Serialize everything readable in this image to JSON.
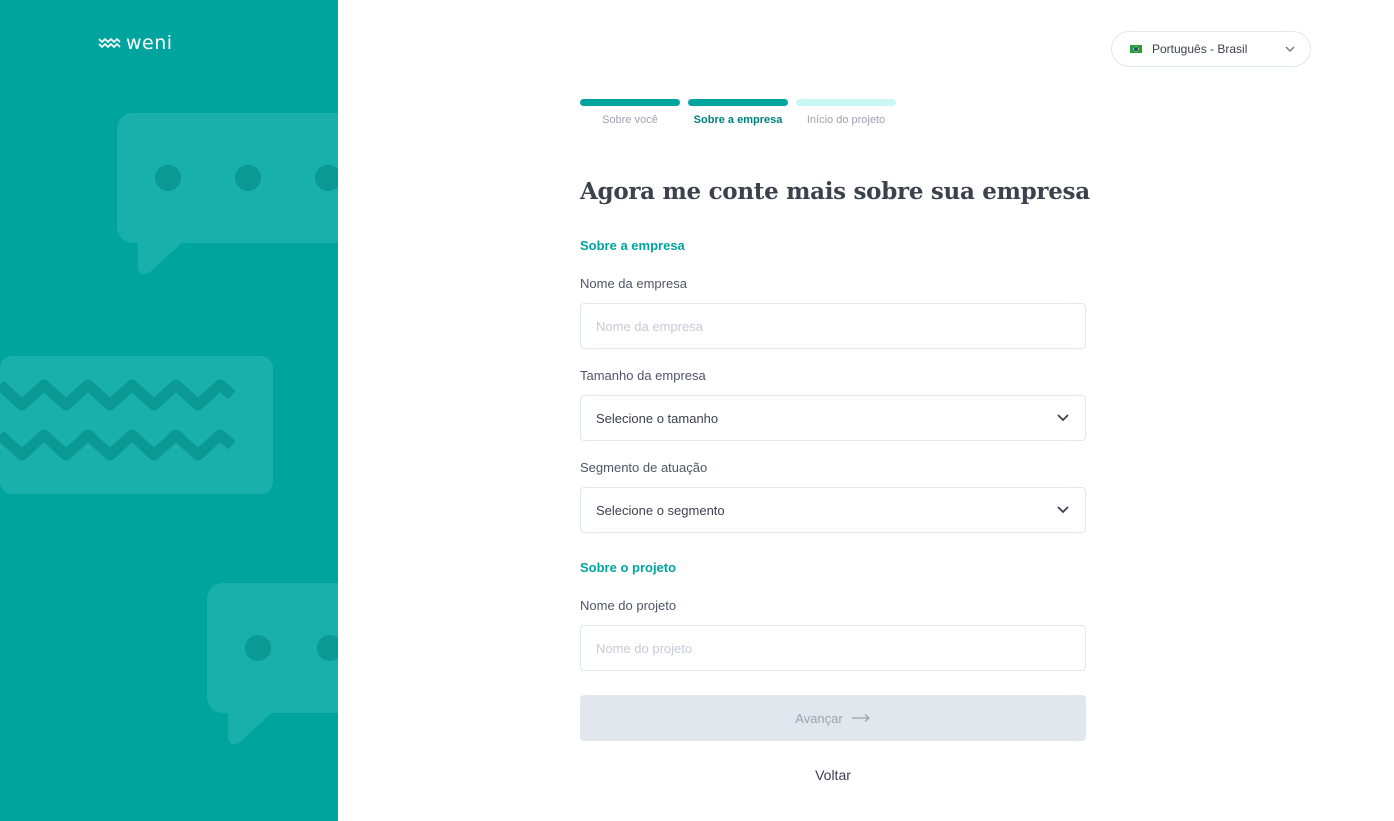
{
  "brand": {
    "name": "weni",
    "color": "#00a49f"
  },
  "language": {
    "selected": "Português - Brasil",
    "flag_icon": "brazil-flag-icon"
  },
  "steps": [
    {
      "label": "Sobre você",
      "status": "completed",
      "bar_color": "#00a49f",
      "label_color": "#9ca3b1"
    },
    {
      "label": "Sobre a empresa",
      "status": "current",
      "bar_color": "#00a49f",
      "label_color": "#00807b"
    },
    {
      "label": "Início do projeto",
      "status": "pending",
      "bar_color": "#c9f7f5",
      "label_color": "#9ca3b1"
    }
  ],
  "form": {
    "title": "Agora me conte mais sobre sua empresa",
    "section_company": "Sobre a empresa",
    "company_name": {
      "label": "Nome da empresa",
      "placeholder": "Nome da empresa",
      "value": ""
    },
    "company_size": {
      "label": "Tamanho da empresa",
      "value": "Selecione o tamanho"
    },
    "segment": {
      "label": "Segmento de atuação",
      "value": "Selecione o segmento"
    },
    "section_project": "Sobre o projeto",
    "project_name": {
      "label": "Nome do projeto",
      "placeholder": "Nome do projeto",
      "value": ""
    },
    "next_button": "Avançar",
    "back_button": "Voltar"
  }
}
